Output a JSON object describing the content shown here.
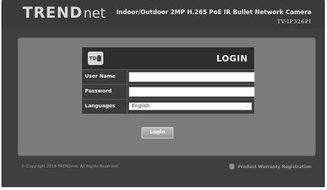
{
  "header": {
    "logo_main": "TREND",
    "logo_net": "net",
    "product_title": "Indoor/Outdoor 2MP H.265 PoE IR Bullet Network Camera",
    "model": "TV-IP326PI"
  },
  "login": {
    "title": "LOGIN",
    "icon_text": "TD",
    "user_label": "User Name",
    "user_value": "",
    "password_label": "Password",
    "password_value": "",
    "language_label": "Languages",
    "language_selected": "English",
    "button": "Login"
  },
  "footer": {
    "copyright": "© Copyright 2018 TRENDnet. All Rights Reserved.",
    "warranty": "Product Warranty Registration"
  }
}
